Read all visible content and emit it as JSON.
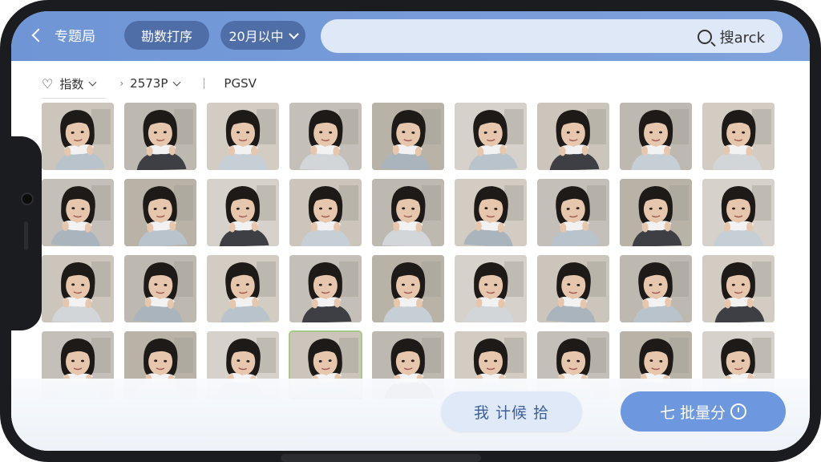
{
  "topbar": {
    "back_label": "专题局",
    "pill_1": "勘数打序",
    "pill_2": "20月以中",
    "search_text": "搜arck"
  },
  "filters": {
    "filter_1": "指数",
    "filter_2": "2573P",
    "filter_3": "PGSV"
  },
  "gallery": {
    "rows": 4,
    "columns": 9,
    "selected_index": 30,
    "colors": {
      "skin": "#e6c6ad",
      "hair": "#1d1a18",
      "towel": "#f2f2f2",
      "background": "#c9c3b8"
    }
  },
  "actions": {
    "secondary_label": "我 计候 拾",
    "primary_label": "七 批量分"
  },
  "colors": {
    "topbar": "#7a9edb",
    "accent": "#6d97df",
    "pill": "#4f6ea8",
    "search_bg": "#dfe8f7"
  }
}
